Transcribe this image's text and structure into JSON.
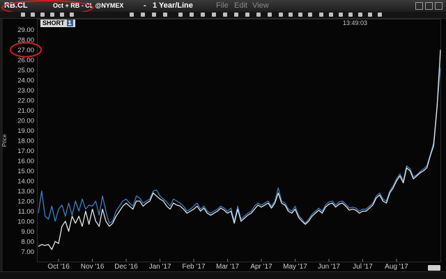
{
  "window": {
    "symbol": "RB.CL",
    "description": "Oct + RB - CL @NYMEX",
    "separator": "-",
    "period": "1 Year/Line",
    "menus": [
      "File",
      "Edit",
      "View"
    ]
  },
  "panel": {
    "tab_label": "SHORT",
    "tab_number": "1",
    "clock": "13:49:03"
  },
  "colors": {
    "background": "#060606",
    "series_blue": "#3d7fc0",
    "series_white": "#e6e6e6",
    "highlight": "#d41e1e"
  },
  "chart_data": {
    "type": "line",
    "title": "",
    "xlabel": "",
    "ylabel": "Price",
    "yticks": [
      "7.00",
      "8.00",
      "9.00",
      "10.00",
      "11.00",
      "12.00",
      "13.00",
      "14.00",
      "15.00",
      "16.00",
      "17.00",
      "18.00",
      "19.00",
      "20.00",
      "21.00",
      "22.00",
      "23.00",
      "24.00",
      "25.00",
      "26.00",
      "27.00",
      "28.00",
      "29.00"
    ],
    "ylim": [
      6.0,
      30.0
    ],
    "xticks": [
      "Oct '16",
      "Nov '16",
      "Dec '16",
      "Jan '17",
      "Feb '17",
      "Mar '17",
      "Apr '17",
      "May '17",
      "Jun '17",
      "Jul '17",
      "Aug '17"
    ],
    "x_range": [
      -0.6,
      11.3
    ],
    "grid": false,
    "highlighted_ytick": "27.00",
    "series": [
      {
        "color": "blue",
        "x": [
          -0.6,
          -0.5,
          -0.4,
          -0.3,
          -0.2,
          -0.1,
          0.0,
          0.1,
          0.2,
          0.3,
          0.4,
          0.5,
          0.6,
          0.7,
          0.8,
          0.9,
          1.0,
          1.1,
          1.2,
          1.3,
          1.4,
          1.5,
          1.6,
          1.7,
          1.8,
          1.9,
          2.0,
          2.1,
          2.2,
          2.3,
          2.4,
          2.5,
          2.6,
          2.7,
          2.8,
          2.9,
          3.0,
          3.1,
          3.2,
          3.3,
          3.4,
          3.5,
          3.6,
          3.7,
          3.8,
          3.9,
          4.0,
          4.1,
          4.2,
          4.3,
          4.4,
          4.5,
          4.6,
          4.7,
          4.8,
          4.9,
          5.0,
          5.1,
          5.2,
          5.3,
          5.4,
          5.5,
          5.6,
          5.7,
          5.8,
          5.9,
          6.0,
          6.1,
          6.2,
          6.3,
          6.4,
          6.5,
          6.6,
          6.7,
          6.8,
          6.9,
          7.0,
          7.1,
          7.2,
          7.3,
          7.4,
          7.5,
          7.6,
          7.7,
          7.8,
          7.9,
          8.0,
          8.1,
          8.2,
          8.3,
          8.4,
          8.5,
          8.6,
          8.7,
          8.8,
          8.9,
          9.0,
          9.1,
          9.2,
          9.3,
          9.4,
          9.5,
          9.6,
          9.7,
          9.8,
          9.9,
          10.0,
          10.1,
          10.2,
          10.3,
          10.4,
          10.5,
          10.6,
          10.7,
          10.8,
          10.9,
          11.0,
          11.1,
          11.2,
          11.3
        ],
        "y": [
          10.8,
          13.0,
          10.5,
          10.2,
          11.5,
          10.0,
          11.2,
          11.6,
          10.5,
          11.8,
          10.6,
          12.0,
          11.0,
          12.2,
          11.2,
          11.6,
          11.5,
          12.0,
          10.6,
          12.5,
          11.0,
          9.8,
          10.0,
          11.0,
          11.5,
          12.0,
          12.2,
          11.8,
          11.5,
          12.5,
          12.3,
          11.8,
          12.0,
          12.2,
          13.0,
          13.1,
          12.5,
          12.2,
          11.9,
          11.5,
          12.2,
          12.0,
          11.8,
          11.5,
          11.0,
          11.2,
          11.5,
          11.8,
          11.2,
          11.5,
          11.0,
          10.8,
          11.0,
          11.2,
          11.5,
          11.3,
          11.0,
          11.3,
          10.0,
          11.5,
          10.2,
          10.5,
          10.8,
          11.0,
          11.5,
          11.8,
          11.6,
          11.8,
          12.0,
          11.5,
          12.0,
          13.3,
          12.0,
          11.8,
          11.2,
          11.0,
          11.5,
          10.6,
          10.2,
          9.8,
          10.2,
          10.7,
          11.0,
          11.3,
          11.0,
          11.6,
          11.9,
          12.0,
          11.6,
          11.9,
          12.0,
          11.7,
          11.3,
          11.4,
          11.3,
          11.0,
          11.2,
          11.2,
          11.5,
          11.8,
          12.5,
          12.8,
          12.2,
          12.0,
          13.0,
          13.5,
          14.2,
          14.7,
          14.0,
          15.5,
          15.2,
          14.4,
          14.6,
          14.9,
          15.2,
          15.5,
          16.6,
          17.8,
          21.5,
          25.2
        ],
        "last_value": 25.2
      },
      {
        "color": "white",
        "x": [
          -0.6,
          -0.5,
          -0.4,
          -0.3,
          -0.2,
          -0.1,
          0.0,
          0.1,
          0.2,
          0.3,
          0.4,
          0.5,
          0.6,
          0.7,
          0.8,
          0.9,
          1.0,
          1.1,
          1.2,
          1.3,
          1.4,
          1.5,
          1.6,
          1.7,
          1.8,
          1.9,
          2.0,
          2.1,
          2.2,
          2.3,
          2.4,
          2.5,
          2.6,
          2.7,
          2.8,
          2.9,
          3.0,
          3.1,
          3.2,
          3.3,
          3.4,
          3.5,
          3.6,
          3.7,
          3.8,
          3.9,
          4.0,
          4.1,
          4.2,
          4.3,
          4.4,
          4.5,
          4.6,
          4.7,
          4.8,
          4.9,
          5.0,
          5.1,
          5.2,
          5.3,
          5.4,
          5.5,
          5.6,
          5.7,
          5.8,
          5.9,
          6.0,
          6.1,
          6.2,
          6.3,
          6.4,
          6.5,
          6.6,
          6.7,
          6.8,
          6.9,
          7.0,
          7.1,
          7.2,
          7.3,
          7.4,
          7.5,
          7.6,
          7.7,
          7.8,
          7.9,
          8.0,
          8.1,
          8.2,
          8.3,
          8.4,
          8.5,
          8.6,
          8.7,
          8.8,
          8.9,
          9.0,
          9.1,
          9.2,
          9.3,
          9.4,
          9.5,
          9.6,
          9.7,
          9.8,
          9.9,
          10.0,
          10.1,
          10.2,
          10.3,
          10.4,
          10.5,
          10.6,
          10.7,
          10.8,
          10.9,
          11.0,
          11.1,
          11.2,
          11.3
        ],
        "y": [
          7.5,
          7.7,
          7.6,
          7.7,
          7.2,
          8.0,
          7.8,
          9.5,
          10.0,
          9.0,
          10.5,
          9.8,
          10.5,
          9.5,
          11.0,
          9.7,
          11.2,
          10.0,
          9.5,
          11.2,
          10.0,
          9.5,
          9.8,
          10.5,
          11.0,
          11.5,
          11.8,
          11.5,
          11.2,
          12.0,
          12.0,
          11.5,
          11.8,
          12.0,
          12.8,
          12.5,
          12.2,
          12.0,
          11.5,
          11.2,
          11.8,
          11.6,
          11.5,
          11.2,
          10.8,
          11.0,
          11.2,
          11.5,
          11.0,
          11.3,
          10.8,
          10.6,
          10.8,
          11.0,
          11.3,
          11.1,
          10.8,
          11.0,
          9.8,
          11.2,
          10.0,
          10.3,
          10.6,
          10.8,
          11.2,
          11.6,
          11.4,
          11.6,
          11.8,
          11.3,
          11.8,
          12.8,
          11.8,
          11.6,
          11.0,
          10.8,
          11.2,
          10.4,
          10.0,
          9.7,
          10.0,
          10.5,
          10.8,
          11.1,
          10.8,
          11.4,
          11.7,
          11.8,
          11.4,
          11.7,
          11.8,
          11.5,
          11.1,
          11.2,
          11.1,
          10.8,
          11.0,
          11.0,
          11.3,
          11.6,
          12.3,
          12.6,
          12.0,
          11.8,
          12.8,
          13.3,
          14.0,
          14.5,
          13.8,
          15.3,
          15.0,
          14.2,
          14.5,
          14.8,
          15.0,
          15.3,
          16.5,
          17.5,
          21.3,
          27.0
        ],
        "last_value": 27.0
      }
    ]
  }
}
